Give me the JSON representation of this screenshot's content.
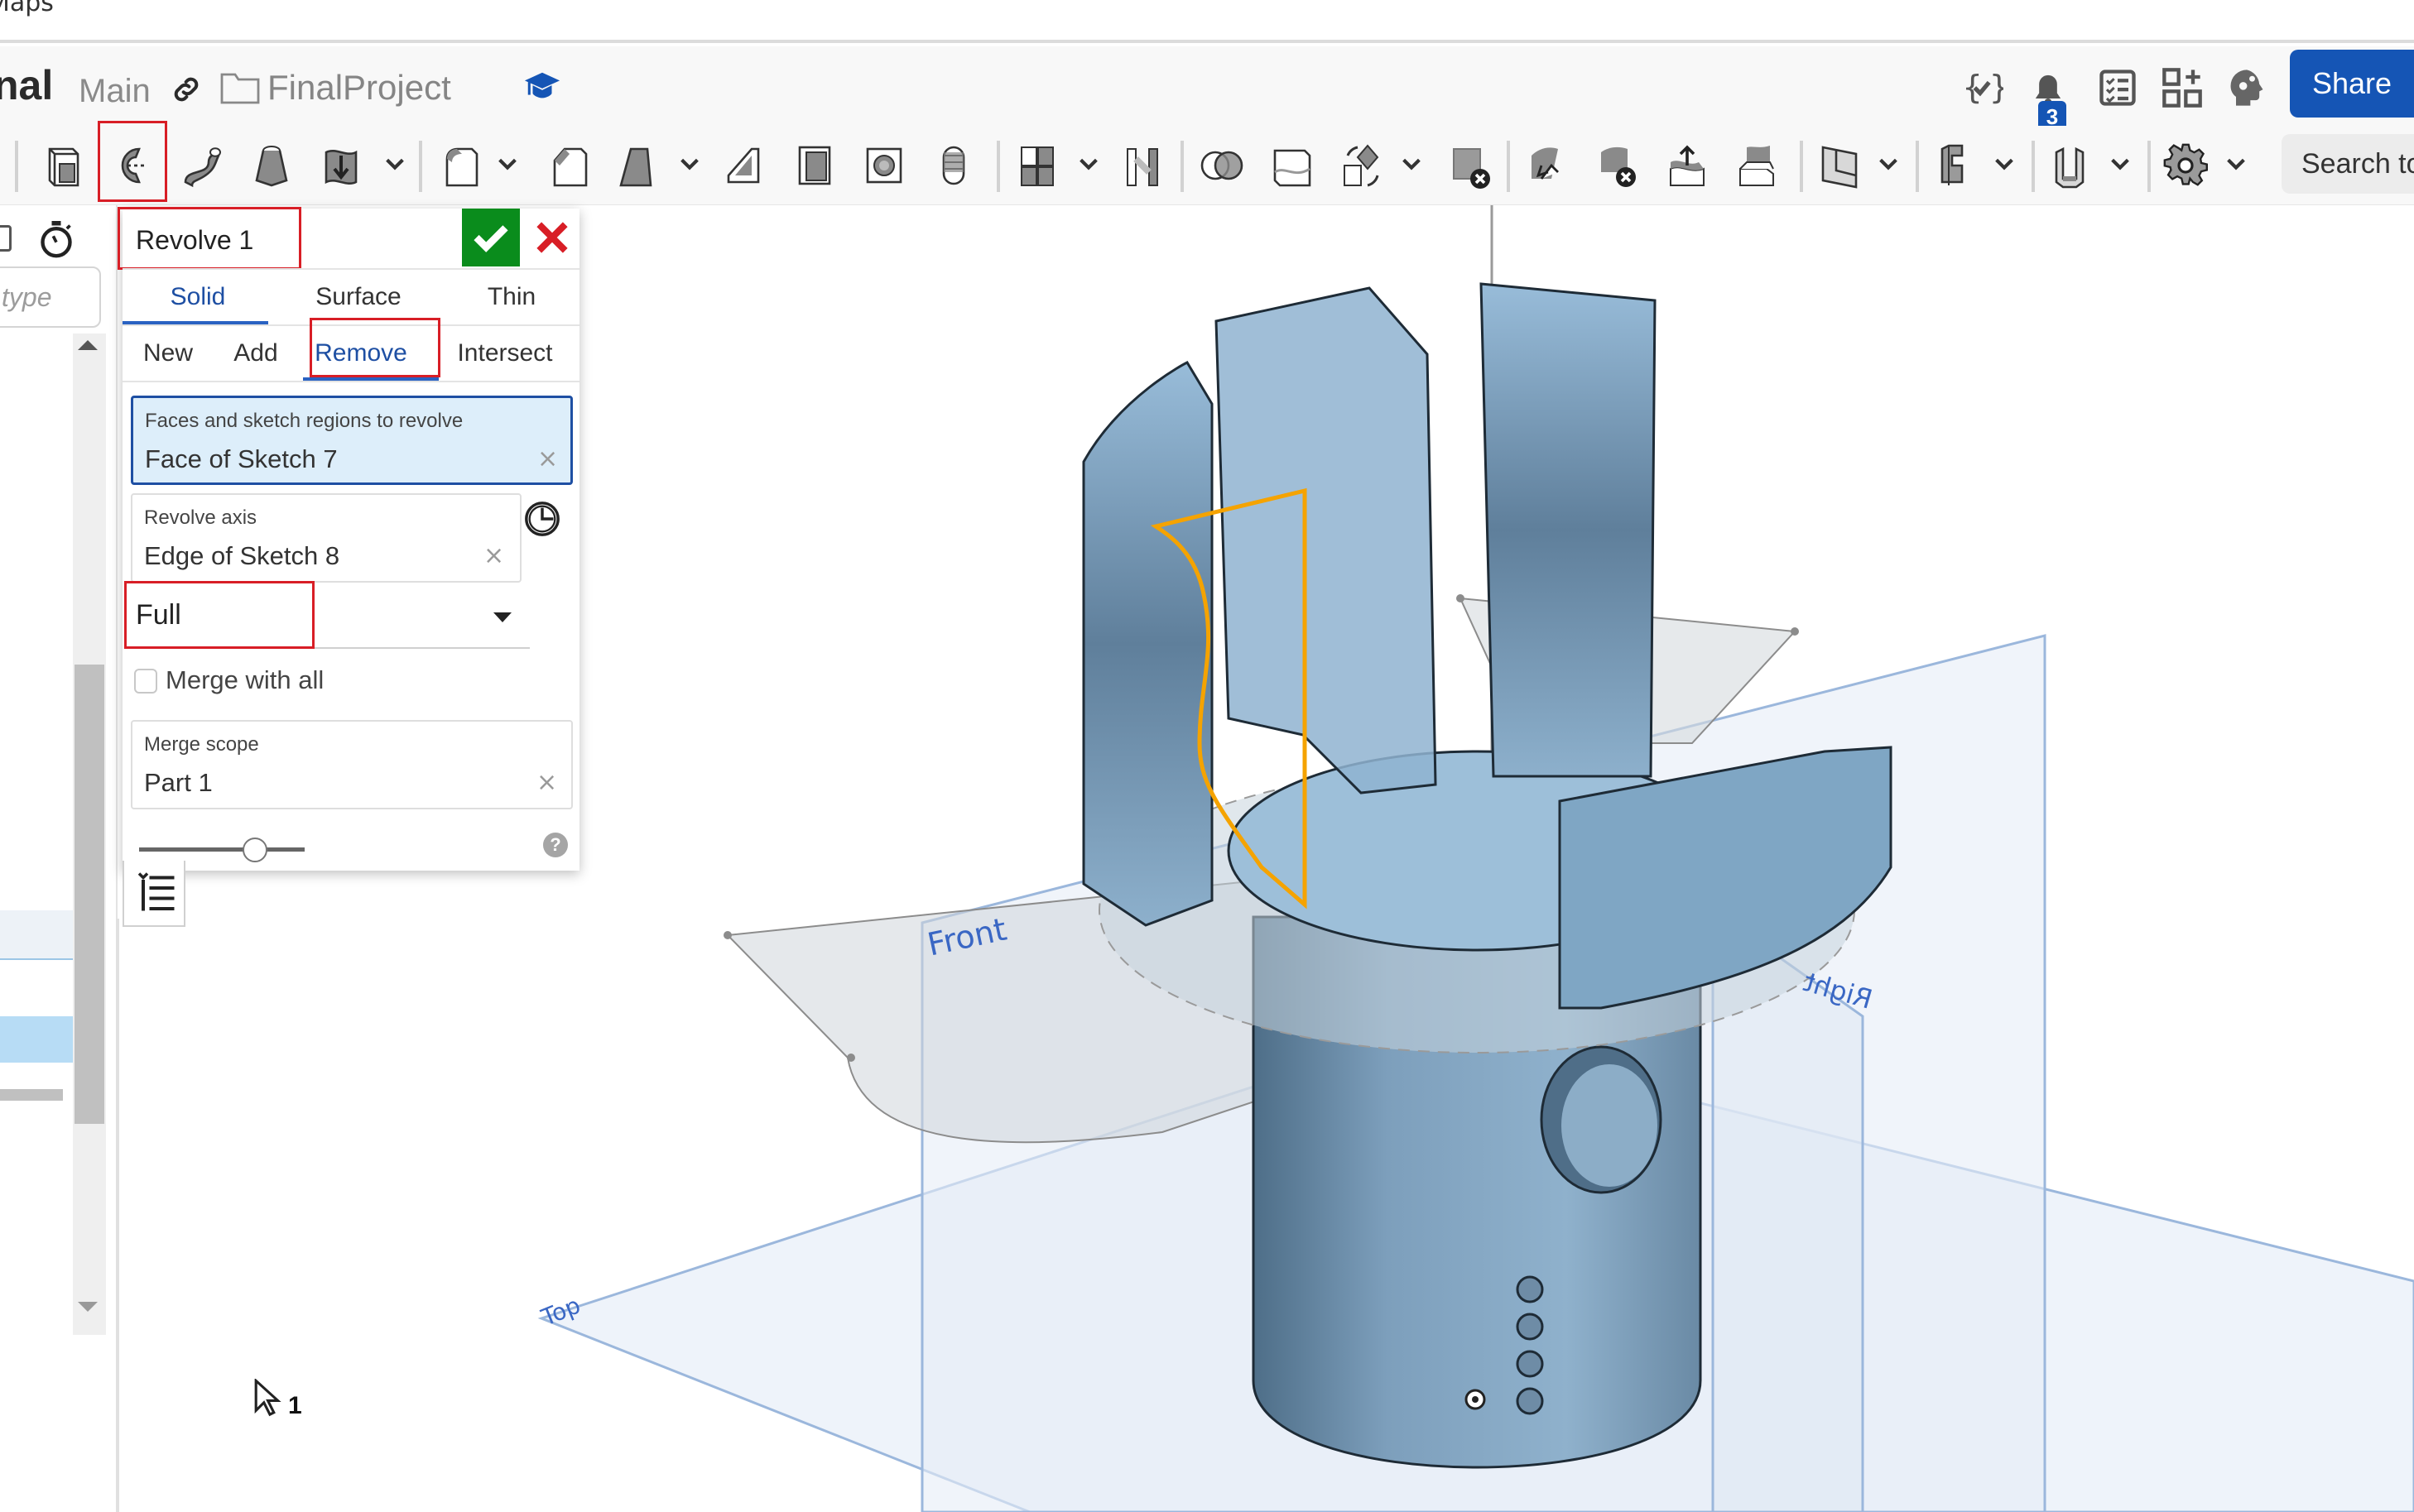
{
  "bookmarks": {
    "partial_label": "Maps"
  },
  "header": {
    "doc_title_partial": "nal",
    "branch": "Main",
    "folder": "FinalProject",
    "notification_count": "3",
    "share_label": "Share"
  },
  "toolbar": {
    "search_placeholder": "Search to",
    "tools": [
      "extrude",
      "revolve",
      "sweep",
      "loft",
      "thicken",
      "fillet",
      "chamfer",
      "draft",
      "rib",
      "shell",
      "hole",
      "thread",
      "linear-pattern",
      "mirror",
      "boolean",
      "split",
      "transform",
      "delete-part",
      "move-face",
      "delete-face",
      "offset-surface",
      "replace-face",
      "plane",
      "frame",
      "sheet-metal",
      "settings"
    ],
    "active_tool": "revolve"
  },
  "left_panel": {
    "filter_placeholder": "type"
  },
  "dialog": {
    "title": "Revolve 1",
    "ok_label": "Confirm",
    "cancel_label": "Cancel",
    "type_tabs": [
      {
        "label": "Solid",
        "active": true
      },
      {
        "label": "Surface",
        "active": false
      },
      {
        "label": "Thin",
        "active": false
      }
    ],
    "operation_tabs": [
      {
        "label": "New",
        "active": false
      },
      {
        "label": "Add",
        "active": false
      },
      {
        "label": "Remove",
        "active": true
      },
      {
        "label": "Intersect",
        "active": false
      }
    ],
    "faces_field": {
      "label": "Faces and sketch regions to revolve",
      "value": "Face of Sketch 7"
    },
    "axis_field": {
      "label": "Revolve axis",
      "value": "Edge of Sketch 8"
    },
    "revolve_type": "Full",
    "merge_with_all": {
      "label": "Merge with all",
      "checked": false
    },
    "merge_scope": {
      "label": "Merge scope",
      "value": "Part 1"
    },
    "clear_symbol": "×",
    "help_symbol": "?",
    "slider_value": 0.7
  },
  "viewport": {
    "planes": {
      "front": "Front",
      "top": "Top",
      "right": "Right"
    },
    "cursor_count": "1"
  },
  "colors": {
    "accent": "#1555b5",
    "confirm": "#0a8c1c",
    "cancel": "#d81e26",
    "highlight_box": "#d81e26",
    "sketch_profile": "#f5a300",
    "part": "#7fa6c4",
    "plane_label": "#3a67c4"
  }
}
